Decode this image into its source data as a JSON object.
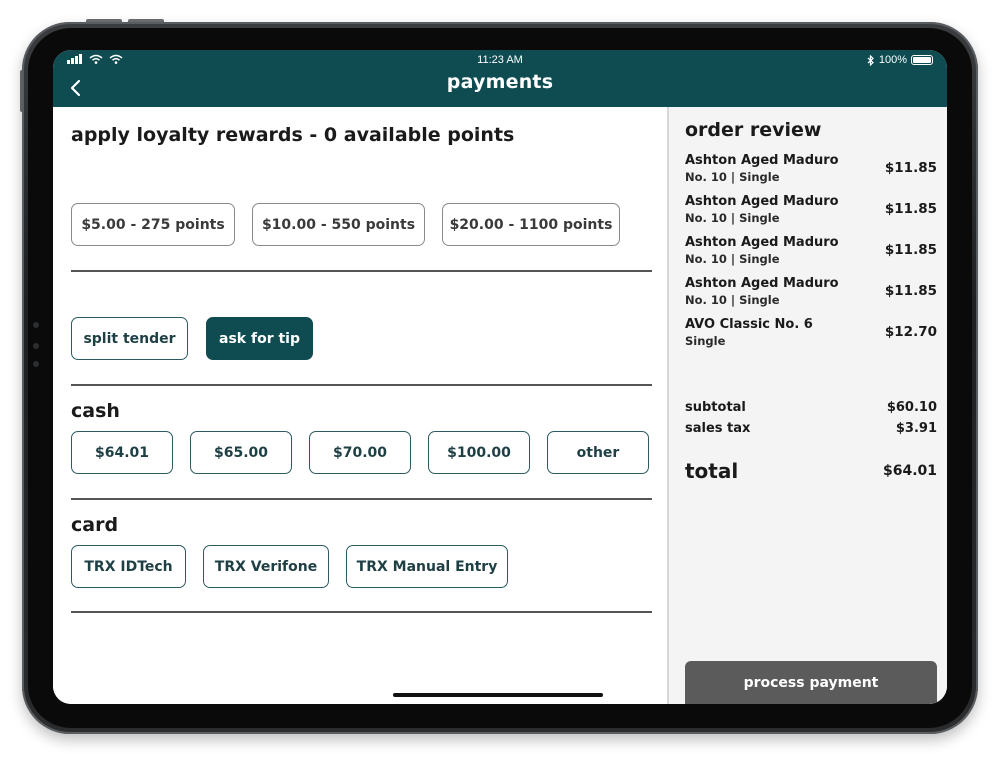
{
  "status_bar": {
    "time": "11:23 AM",
    "battery": "100%"
  },
  "header": {
    "title": "payments"
  },
  "loyalty": {
    "title": "apply loyalty rewards - 0 available points",
    "options": [
      "$5.00 - 275 points",
      "$10.00 - 550 points",
      "$20.00 - 1100 points"
    ]
  },
  "actions": {
    "split_tender": "split tender",
    "ask_for_tip": "ask for tip"
  },
  "cash": {
    "title": "cash",
    "options": [
      "$64.01",
      "$65.00",
      "$70.00",
      "$100.00",
      "other"
    ]
  },
  "card": {
    "title": "card",
    "options": [
      "TRX IDTech",
      "TRX Verifone",
      "TRX Manual Entry"
    ]
  },
  "order_review": {
    "title": "order review",
    "items": [
      {
        "name": "Ashton Aged Maduro",
        "detail": "No. 10 | Single",
        "price": "$11.85"
      },
      {
        "name": "Ashton Aged Maduro",
        "detail": "No. 10 | Single",
        "price": "$11.85"
      },
      {
        "name": "Ashton Aged Maduro",
        "detail": "No. 10 | Single",
        "price": "$11.85"
      },
      {
        "name": "Ashton Aged Maduro",
        "detail": "No. 10 | Single",
        "price": "$11.85"
      },
      {
        "name": "AVO Classic No. 6",
        "detail": "Single",
        "price": "$12.70"
      }
    ],
    "subtotal_label": "subtotal",
    "subtotal_value": "$60.10",
    "tax_label": "sales tax",
    "tax_value": "$3.91",
    "total_label": "total",
    "total_value": "$64.01",
    "process_label": "process payment"
  },
  "colors": {
    "brand": "#0e4c52",
    "process_button": "#5b5b5b"
  }
}
